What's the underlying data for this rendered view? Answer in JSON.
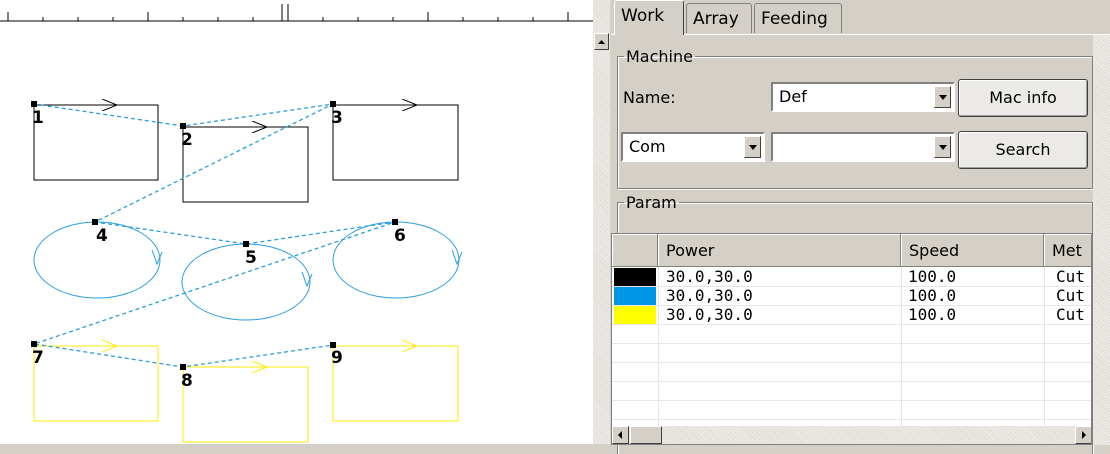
{
  "tabs": [
    {
      "label": "Work",
      "active": true
    },
    {
      "label": "Array",
      "active": false
    },
    {
      "label": "Feeding",
      "active": false
    }
  ],
  "machine": {
    "group_label": "Machine",
    "name_label": "Name:",
    "name_value": "Def",
    "mac_info_label": "Mac info",
    "port_value": "Com",
    "port2_value": "",
    "search_label": "Search"
  },
  "param": {
    "group_label": "Param",
    "columns": [
      "",
      "Power",
      "Speed",
      "Met"
    ],
    "rows": [
      {
        "color": "#000000",
        "power": "30.0,30.0",
        "speed": "100.0",
        "method": "Cut"
      },
      {
        "color": "#0096e6",
        "power": "30.0,30.0",
        "speed": "100.0",
        "method": "Cut"
      },
      {
        "color": "#ffff00",
        "power": "30.0,30.0",
        "speed": "100.0",
        "method": "Cut"
      }
    ]
  },
  "canvas": {
    "colors": {
      "black": "#000000",
      "blue": "#2a9ee0",
      "yellow": "#ffea00"
    },
    "order_labels": [
      "1",
      "2",
      "3",
      "4",
      "5",
      "6",
      "7",
      "8",
      "9"
    ]
  }
}
